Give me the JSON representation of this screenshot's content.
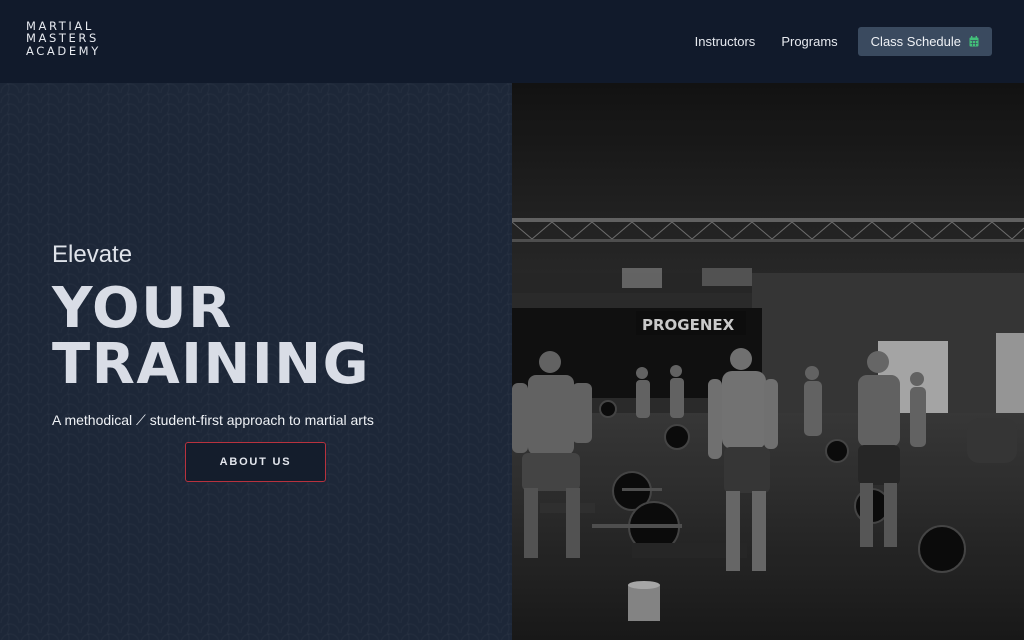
{
  "brand": {
    "line1": "MARTIAL",
    "line2": "MASTERS",
    "line3": "ACADEMY"
  },
  "nav": {
    "instructors": "Instructors",
    "programs": "Programs",
    "schedule": "Class Schedule",
    "schedule_icon": "calendar-icon"
  },
  "hero": {
    "eyebrow": "Elevate",
    "headline_line1": "YOUR",
    "headline_line2": "TRAINING",
    "tagline": "A methodical ⟋ student-first approach to martial arts",
    "cta": "ABOUT US",
    "photo_sign": "PROGENEX"
  },
  "colors": {
    "header_bg": "#111a2b",
    "hero_bg": "#1d2738",
    "cta_border": "#b8323e",
    "schedule_btn": "#3a4a5f",
    "calendar_icon": "#43c07a"
  }
}
